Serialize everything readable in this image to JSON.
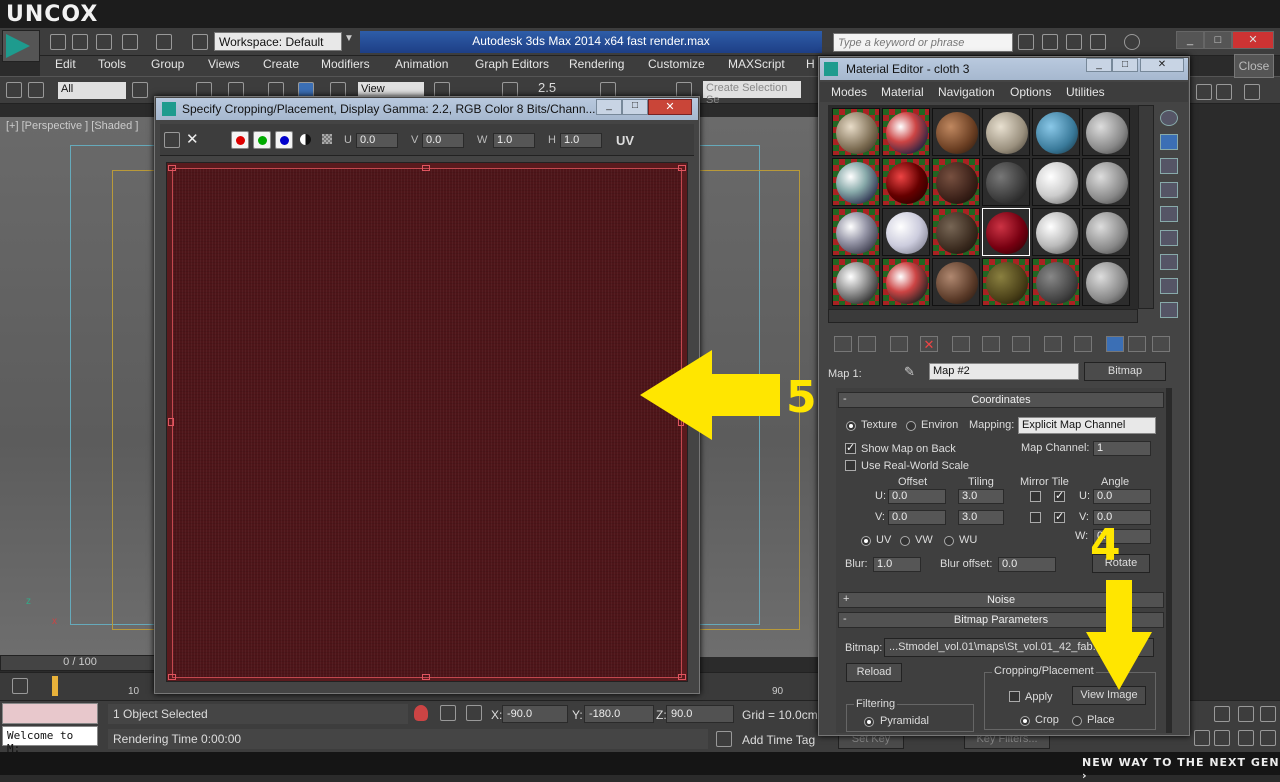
{
  "brand": "UNCOX",
  "app": {
    "title": "Autodesk 3ds Max  2014 x64      fast render.max",
    "workspace": "Workspace: Default",
    "search_placeholder": "Type a keyword or phrase"
  },
  "menu": [
    "Edit",
    "Tools",
    "Group",
    "Views",
    "Create",
    "Modifiers",
    "Animation",
    "Graph Editors",
    "Rendering",
    "Customize",
    "MAXScript",
    "H"
  ],
  "toolbar": {
    "selection_filter": "All",
    "ref_coord": "View",
    "snap_value": "2.5",
    "selection_set_placeholder": "Create Selection Se"
  },
  "viewport": {
    "label": "[+] [Perspective ] [Shaded ]",
    "axis_z": "z",
    "axis_x": "x"
  },
  "timeline": {
    "frame": "0 / 100",
    "tick_10": "10",
    "tick_90": "90"
  },
  "status": {
    "selection": "1 Object Selected",
    "render_time": "Rendering Time  0:00:00",
    "welcome": "Welcome to M:",
    "x_label": "X:",
    "x_value": "-90.0",
    "y_label": "Y:",
    "y_value": "-180.0",
    "z_label": "Z:",
    "z_value": "90.0",
    "grid": "Grid = 10.0cm",
    "add_time_tag": "Add Time Tag",
    "set_key": "Set Key",
    "key_filters": "Key Filters..."
  },
  "slogan": "NEW WAY TO THE NEXT GEN ›",
  "crop_dialog": {
    "title": "Specify Cropping/Placement, Display Gamma: 2.2, RGB Color 8 Bits/Chann...",
    "u_label": "U",
    "u_value": "0.0",
    "v_label": "V",
    "v_value": "0.0",
    "w_label": "W",
    "w_value": "1.0",
    "h_label": "H",
    "h_value": "1.0",
    "uv_toggle": "UV"
  },
  "annotations": {
    "step5": "5",
    "step4": "4",
    "arrow_color": "#ffe600"
  },
  "material_editor": {
    "title": "Material Editor - cloth 3",
    "menu": [
      "Modes",
      "Material",
      "Navigation",
      "Options",
      "Utilities"
    ],
    "map_label": "Map 1:",
    "map_name": "Map #2",
    "map_type": "Bitmap",
    "coordinates": {
      "header": "Coordinates",
      "texture": "Texture",
      "environ": "Environ",
      "mapping_label": "Mapping:",
      "mapping_value": "Explicit Map Channel",
      "show_map_on_back": "Show Map on Back",
      "map_channel_label": "Map Channel:",
      "map_channel_value": "1",
      "real_world_scale": "Use Real-World Scale",
      "offset": "Offset",
      "tiling": "Tiling",
      "mirror_tile": "Mirror Tile",
      "angle": "Angle",
      "u_label": "U:",
      "v_label": "V:",
      "w_label": "W:",
      "offset_u": "0.0",
      "offset_v": "0.0",
      "tiling_u": "3.0",
      "tiling_v": "3.0",
      "angle_u": "0.0",
      "angle_v": "0.0",
      "angle_w": "0.0",
      "uv": "UV",
      "vw": "VW",
      "wu": "WU",
      "blur_label": "Blur:",
      "blur_value": "1.0",
      "blur_offset_label": "Blur offset:",
      "blur_offset_value": "0.0",
      "rotate": "Rotate"
    },
    "noise_header": "Noise",
    "bitmap_params": {
      "header": "Bitmap Parameters",
      "bitmap_label": "Bitmap:",
      "bitmap_path": "...Stmodel_vol.01\\maps\\St_vol.01_42_fab...jpg",
      "reload": "Reload",
      "cropping_placement": "Cropping/Placement",
      "apply": "Apply",
      "view_image": "View Image",
      "crop": "Crop",
      "place": "Place",
      "filtering": "Filtering",
      "pyramidal": "Pyramidal"
    }
  },
  "close_label": "Close"
}
